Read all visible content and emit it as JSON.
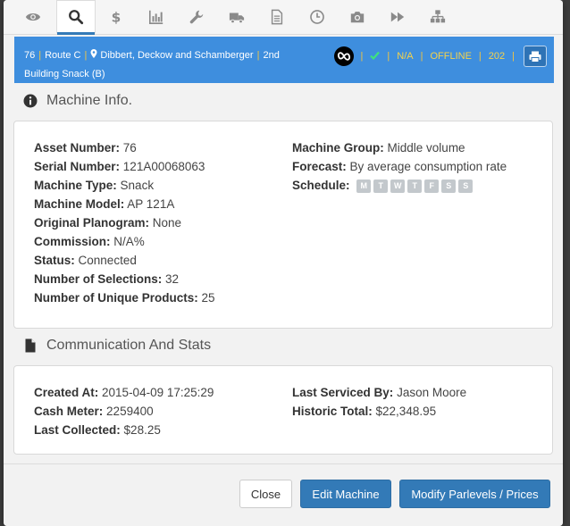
{
  "tabs": [
    {
      "icon": "eye-icon"
    },
    {
      "icon": "search-icon",
      "active": true
    },
    {
      "icon": "dollar-icon"
    },
    {
      "icon": "bar-chart-icon"
    },
    {
      "icon": "wrench-icon"
    },
    {
      "icon": "truck-icon"
    },
    {
      "icon": "document-icon"
    },
    {
      "icon": "clock-icon"
    },
    {
      "icon": "camera-icon"
    },
    {
      "icon": "fast-forward-icon"
    },
    {
      "icon": "sitemap-icon"
    }
  ],
  "infobar": {
    "asset": "76",
    "route": "Route C",
    "location": "Dibbert, Deckow and Schamberger",
    "floor": "2nd",
    "building": "Building Snack (B)",
    "status_na": "N/A",
    "status_offline": "OFFLINE",
    "status_code": "202"
  },
  "machine_info": {
    "title": "Machine Info.",
    "left": [
      {
        "label": "Asset Number:",
        "value": "76"
      },
      {
        "label": "Serial Number:",
        "value": "121A00068063"
      },
      {
        "label": "Machine Type:",
        "value": "Snack"
      },
      {
        "label": "Machine Model:",
        "value": "AP 121A"
      },
      {
        "label": "Original Planogram:",
        "value": "None"
      },
      {
        "label": "Commission:",
        "value": "N/A%"
      },
      {
        "label": "Status:",
        "value": "Connected"
      },
      {
        "label": "Number of Selections:",
        "value": "32"
      },
      {
        "label": "Number of Unique Products:",
        "value": "25"
      }
    ],
    "right": [
      {
        "label": "Machine Group:",
        "value": "Middle volume"
      },
      {
        "label": "Forecast:",
        "value": "By average consumption rate"
      },
      {
        "label": "Schedule:",
        "value": ""
      }
    ],
    "schedule_days": [
      "M",
      "T",
      "W",
      "T",
      "F",
      "S",
      "S"
    ]
  },
  "comm_stats": {
    "title": "Communication And Stats",
    "left": [
      {
        "label": "Created At:",
        "value": "2015-04-09 17:25:29"
      },
      {
        "label": "Cash Meter:",
        "value": "2259400"
      },
      {
        "label": "Last Collected:",
        "value": "$28.25"
      }
    ],
    "right": [
      {
        "label": "Last Serviced By:",
        "value": "Jason Moore"
      },
      {
        "label": "Historic Total:",
        "value": "$22,348.95"
      }
    ]
  },
  "footer": {
    "close_label": "Close",
    "edit_label": "Edit Machine",
    "modify_label": "Modify Parlevels / Prices"
  },
  "colors": {
    "infobar": "#3e8ede",
    "primary": "#337ab7",
    "warn": "#f6d34a",
    "ok": "#3fe27d"
  }
}
